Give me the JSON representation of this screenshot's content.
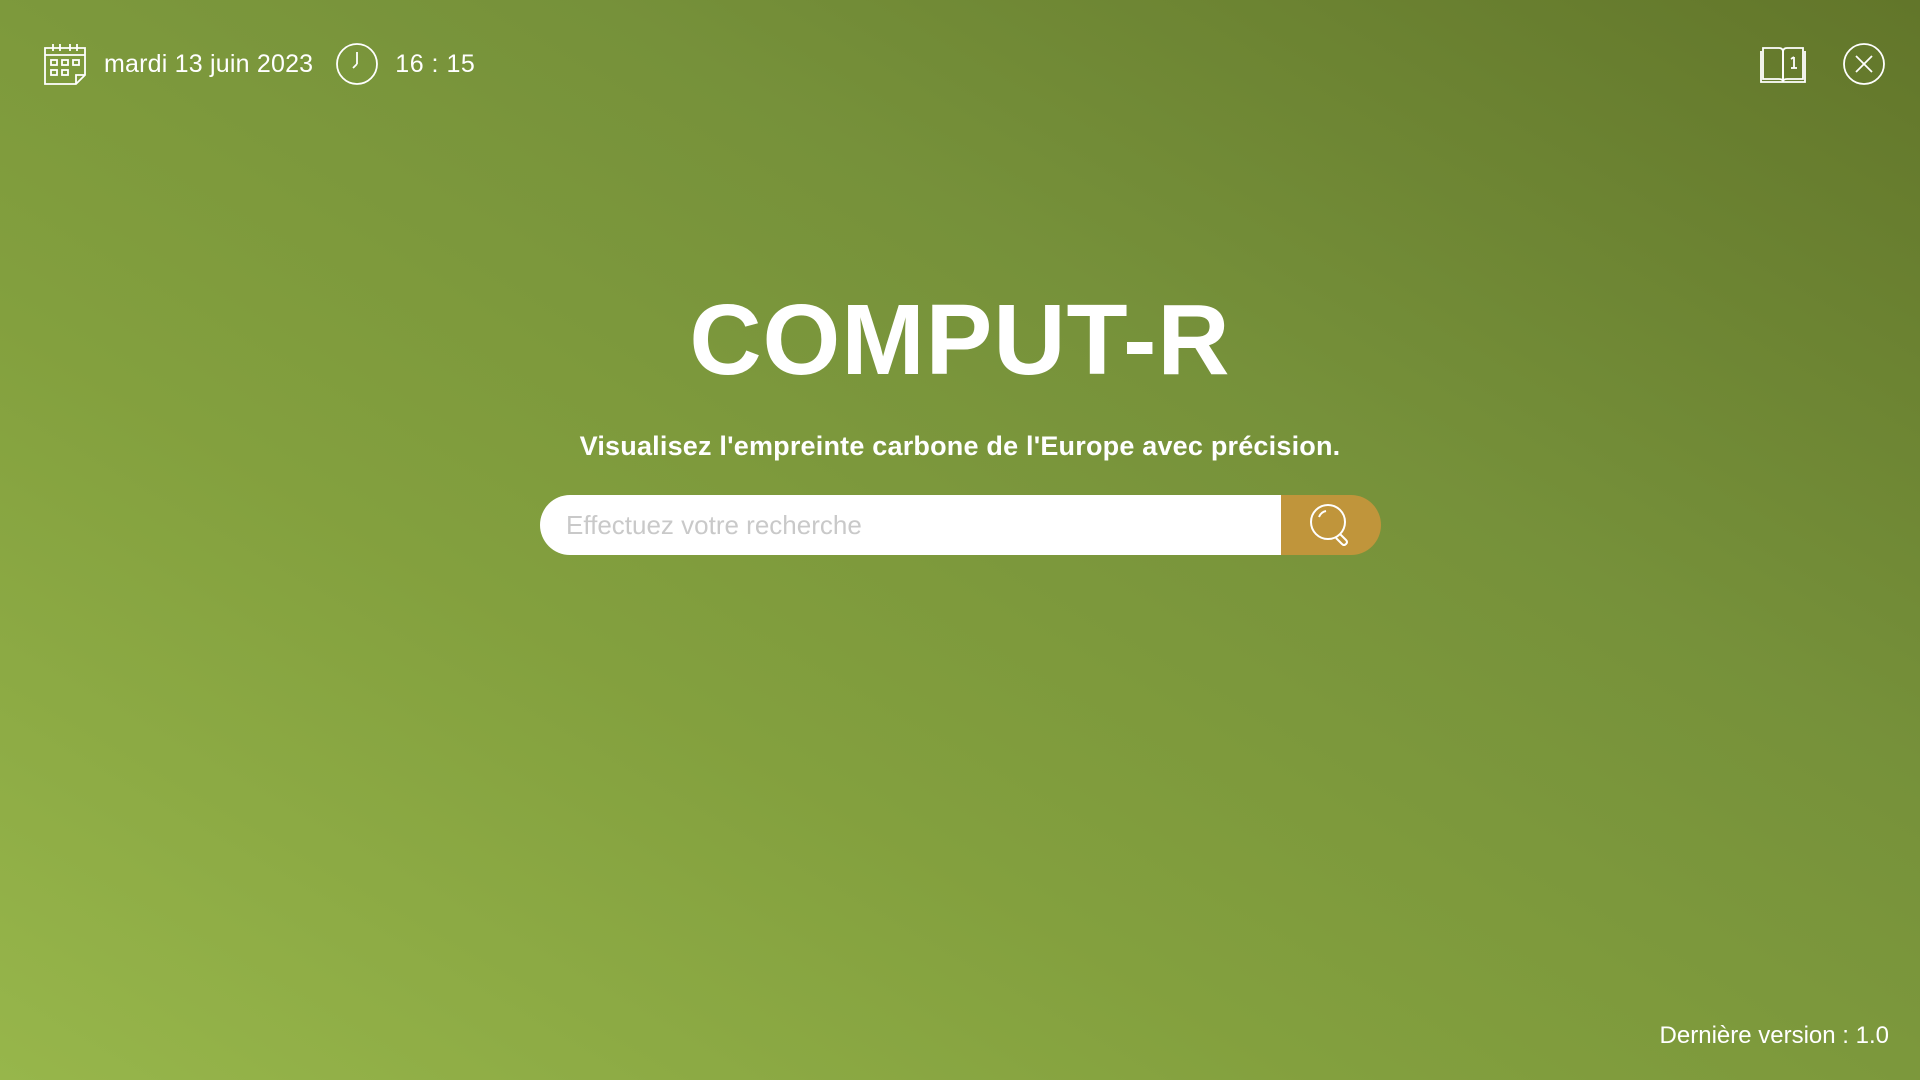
{
  "header": {
    "date": "mardi 13 juin 2023",
    "time": "16 : 15",
    "icons": {
      "calendar": "calendar-icon",
      "clock": "clock-icon",
      "guide": "book-info-icon",
      "close": "close-icon"
    }
  },
  "hero": {
    "title": "COMPUT-R",
    "tagline": "Visualisez l'empreinte carbone de l'Europe avec précision."
  },
  "search": {
    "placeholder": "Effectuez votre recherche",
    "value": "",
    "button_icon": "search-icon"
  },
  "footer": {
    "version": "Dernière version : 1.0"
  },
  "colors": {
    "background_light": "#97b64b",
    "background_dark": "#62762a",
    "accent": "#c0953b",
    "text": "#ffffff"
  }
}
